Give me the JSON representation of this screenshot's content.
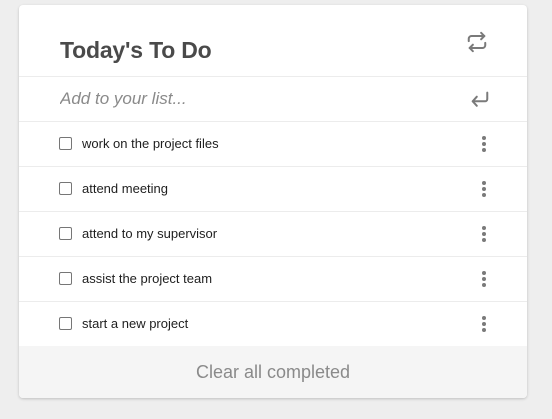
{
  "header": {
    "title": "Today's To Do",
    "refresh_icon": "refresh-icon"
  },
  "add_item": {
    "placeholder": "Add to your list...",
    "value": "",
    "enter_icon": "enter-return-icon"
  },
  "todos": [
    {
      "text": "work on the project files",
      "checked": false
    },
    {
      "text": "attend meeting",
      "checked": false
    },
    {
      "text": "attend to my supervisor",
      "checked": false
    },
    {
      "text": "assist the project team",
      "checked": false
    },
    {
      "text": "start a new project",
      "checked": false
    }
  ],
  "item_menu_icon": "vertical-dots-icon",
  "footer": {
    "clear_label": "Clear all completed"
  },
  "colors": {
    "page_bg": "#eeeeee",
    "card_bg": "#ffffff",
    "title": "#4a4a4a",
    "icon": "#7a7a7a",
    "footer_bg": "#f5f5f5",
    "footer_text": "#8a8a8a"
  }
}
